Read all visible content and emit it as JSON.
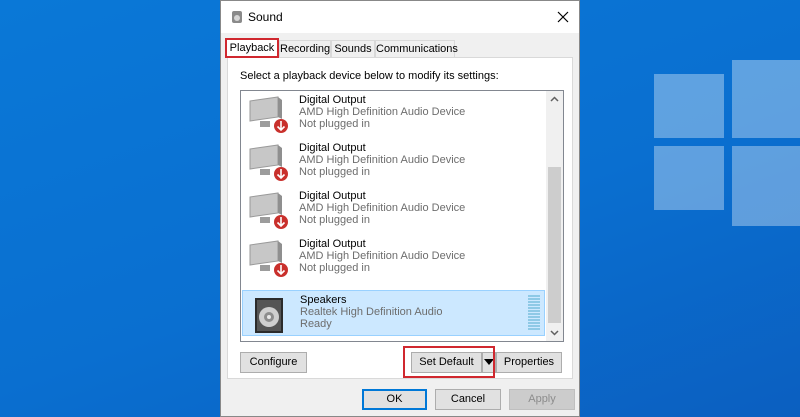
{
  "window": {
    "title": "Sound"
  },
  "tabs": [
    {
      "label": "Playback"
    },
    {
      "label": "Recording"
    },
    {
      "label": "Sounds"
    },
    {
      "label": "Communications"
    }
  ],
  "panel": {
    "instruction": "Select a playback device below to modify its settings:"
  },
  "devices": [
    {
      "name": "Digital Output",
      "desc": "AMD High Definition Audio Device",
      "status": "Not plugged in"
    },
    {
      "name": "Digital Output",
      "desc": "AMD High Definition Audio Device",
      "status": "Not plugged in"
    },
    {
      "name": "Digital Output",
      "desc": "AMD High Definition Audio Device",
      "status": "Not plugged in"
    },
    {
      "name": "Digital Output",
      "desc": "AMD High Definition Audio Device",
      "status": "Not plugged in"
    },
    {
      "name": "Speakers",
      "desc": "Realtek High Definition Audio",
      "status": "Ready"
    }
  ],
  "buttons": {
    "configure": "Configure",
    "set_default": "Set Default",
    "properties": "Properties",
    "ok": "OK",
    "cancel": "Cancel",
    "apply": "Apply"
  },
  "colors": {
    "accent": "#0078d7",
    "highlight": "#d0282f",
    "selection": "#cce8ff"
  }
}
